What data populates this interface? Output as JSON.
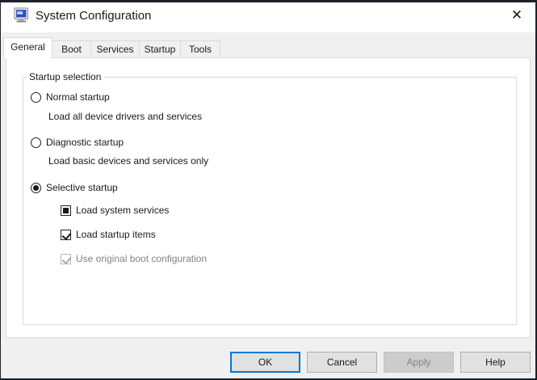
{
  "window": {
    "title": "System Configuration"
  },
  "icons": {
    "close": "✕",
    "app": "msconfig-monitor"
  },
  "colors": {
    "accent": "#0078d7",
    "window_border": "#1c222a",
    "dialog_bg": "#f0f0f0",
    "page_bg": "#ffffff",
    "groupbox_border": "#dcdcdc",
    "disabled_text": "#838383",
    "button_bg": "#e1e1e1",
    "disabled_button_bg": "#cccccc"
  },
  "tabs": [
    {
      "label": "General",
      "active": true
    },
    {
      "label": "Boot",
      "active": false
    },
    {
      "label": "Services",
      "active": false
    },
    {
      "label": "Startup",
      "active": false
    },
    {
      "label": "Tools",
      "active": false
    }
  ],
  "general_tab": {
    "group_label": "Startup selection",
    "startup_options": [
      {
        "label": "Normal startup",
        "description": "Load all device drivers and services",
        "selected": false
      },
      {
        "label": "Diagnostic startup",
        "description": "Load basic devices and services only",
        "selected": false
      },
      {
        "label": "Selective startup",
        "description": "",
        "selected": true
      }
    ],
    "selective_sub_options": [
      {
        "label": "Load system services",
        "state": "indeterminate",
        "enabled": true
      },
      {
        "label": "Load startup items",
        "state": "checked",
        "enabled": true
      },
      {
        "label": "Use original boot configuration",
        "state": "checked",
        "enabled": false
      }
    ]
  },
  "footer_buttons": [
    {
      "label": "OK",
      "state": "default"
    },
    {
      "label": "Cancel",
      "state": "normal"
    },
    {
      "label": "Apply",
      "state": "disabled"
    },
    {
      "label": "Help",
      "state": "normal"
    }
  ]
}
